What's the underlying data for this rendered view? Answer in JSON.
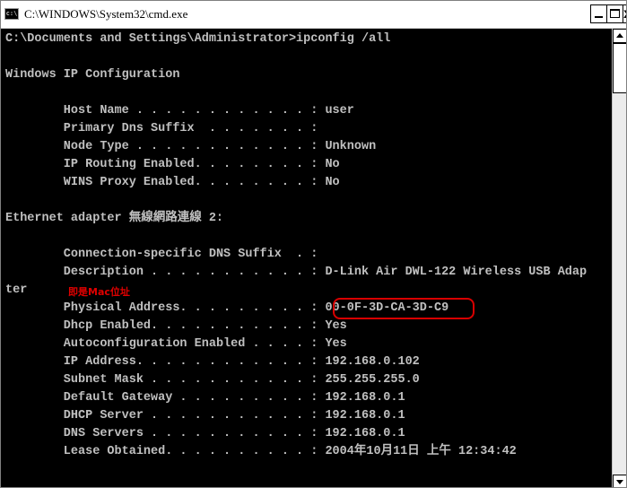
{
  "window": {
    "title": "C:\\WINDOWS\\System32\\cmd.exe",
    "icon_name": "command-prompt-icon",
    "icon_text": "c:\\",
    "controls": [
      "minimize-icon",
      "maximize-icon",
      "close-icon"
    ],
    "close_glyph": "x"
  },
  "console": {
    "text_color": "#c0c0c0",
    "background": "#000000",
    "lines": [
      "C:\\Documents and Settings\\Administrator>ipconfig /all",
      "",
      "Windows IP Configuration",
      "",
      "        Host Name . . . . . . . . . . . . : user",
      "        Primary Dns Suffix  . . . . . . . :",
      "        Node Type . . . . . . . . . . . . : Unknown",
      "        IP Routing Enabled. . . . . . . . : No",
      "        WINS Proxy Enabled. . . . . . . . : No",
      "",
      "Ethernet adapter 無線網路連線 2:",
      "",
      "        Connection-specific DNS Suffix  . :",
      "        Description . . . . . . . . . . . : D-Link Air DWL-122 Wireless USB Adap",
      "ter",
      "        Physical Address. . . . . . . . . : 00-0F-3D-CA-3D-C9",
      "        Dhcp Enabled. . . . . . . . . . . : Yes",
      "        Autoconfiguration Enabled . . . . : Yes",
      "        IP Address. . . . . . . . . . . . : 192.168.0.102",
      "        Subnet Mask . . . . . . . . . . . : 255.255.255.0",
      "        Default Gateway . . . . . . . . . : 192.168.0.1",
      "        DHCP Server . . . . . . . . . . . : 192.168.0.1",
      "        DNS Servers . . . . . . . . . . . : 192.168.0.1",
      "        Lease Obtained. . . . . . . . . . : 2004年10月11日 上午 12:34:42"
    ]
  },
  "annotation": {
    "text": "即是Mac位址",
    "color": "#e00000",
    "highlight_color": "#d80000"
  }
}
